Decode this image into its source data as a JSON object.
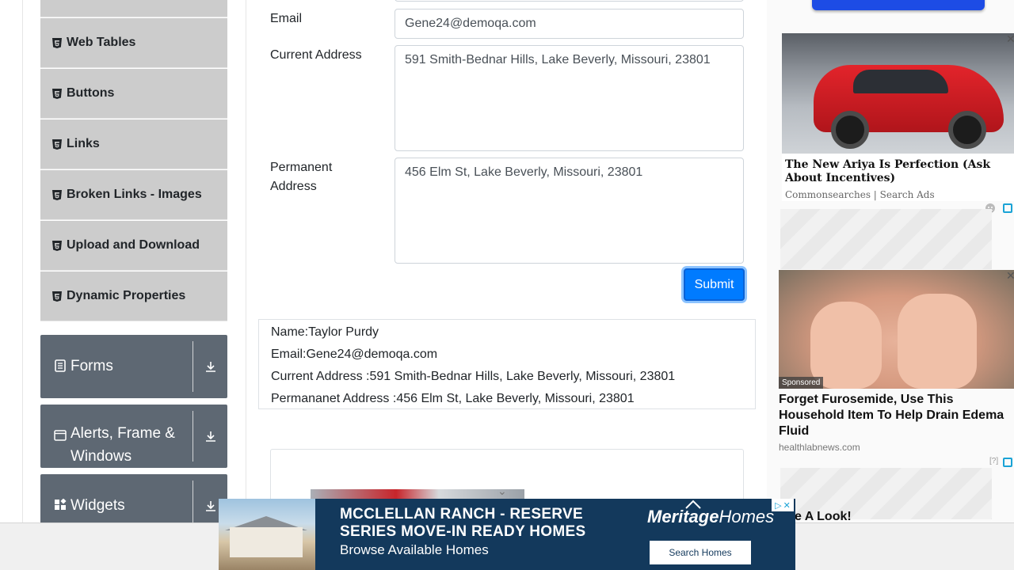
{
  "sidebar": {
    "items": [
      {
        "label": "Web Tables",
        "icon": "html5-icon"
      },
      {
        "label": "Buttons",
        "icon": "html5-icon"
      },
      {
        "label": "Links",
        "icon": "html5-icon"
      },
      {
        "label": "Broken Links - Images",
        "icon": "html5-icon"
      },
      {
        "label": "Upload and Download",
        "icon": "html5-icon"
      },
      {
        "label": "Dynamic Properties",
        "icon": "html5-icon"
      }
    ],
    "groups": [
      {
        "label": "Forms",
        "icon": "document-icon"
      },
      {
        "label": "Alerts, Frame & Windows",
        "icon": "window-icon"
      },
      {
        "label": "Widgets",
        "icon": "widgets-icon"
      }
    ]
  },
  "form": {
    "email_label": "Email",
    "email_value": "Gene24@demoqa.com",
    "current_address_label": "Current Address",
    "current_address_value": "591 Smith-Bednar Hills, Lake Beverly, Missouri, 23801",
    "permanent_address_label": "Permanent Address",
    "permanent_address_value": "456 Elm St, Lake Beverly, Missouri, 23801",
    "submit_label": "Submit"
  },
  "output": {
    "name": "Name:Taylor Purdy",
    "email": "Email:Gene24@demoqa.com",
    "current_address": "Current Address :591 Smith-Bednar Hills, Lake Beverly, Missouri, 23801",
    "permanent_address": "Permananet Address :456 Elm St, Lake Beverly, Missouri, 23801"
  },
  "ads": {
    "car": {
      "title": "The New Ariya Is Perfection (Ask About Incentives)",
      "source": "Commonsearches | Search Ads"
    },
    "health": {
      "sponsored": "Sponsored",
      "title": "Forget Furosemide, Use This Household Item To Help Drain Edema Fluid",
      "source": "healthlabnews.com",
      "qmark": "[?]",
      "behind_text": "e A Look!"
    },
    "banner": {
      "headline_1": "MCCLELLAN RANCH - RESERVE",
      "headline_2": "SERIES MOVE-IN READY HOMES",
      "subtitle": "Browse Available Homes",
      "logo_1": "Meritage",
      "logo_2": "Homes",
      "cta": "Search Homes"
    }
  },
  "colors": {
    "primary": "#007bff",
    "sidebar_item_bg": "#cccccc",
    "group_bg": "#5e6873",
    "banner_bg": "#13395c"
  }
}
